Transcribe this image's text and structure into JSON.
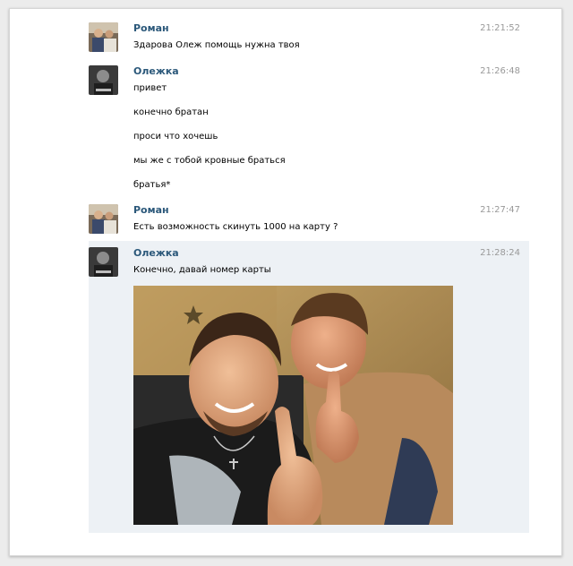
{
  "colors": {
    "author_link": "#2b587a",
    "timestamp": "#999999",
    "highlight_bg": "#edf1f5"
  },
  "messages": [
    {
      "author": "Роман",
      "time": "21:21:52",
      "avatar_icon": "user-avatar-roman",
      "lines": [
        "Здарова Олеж помощь нужна твоя"
      ]
    },
    {
      "author": "Олежка",
      "time": "21:26:48",
      "avatar_icon": "user-avatar-olezhka",
      "lines": [
        "привет",
        "конечно братан",
        "проси что хочешь",
        "мы же с тобой кровные браться",
        "братья*"
      ]
    },
    {
      "author": "Роман",
      "time": "21:27:47",
      "avatar_icon": "user-avatar-roman",
      "lines": [
        "Есть возможность скинуть 1000 на карту ?"
      ]
    },
    {
      "author": "Олежка",
      "time": "21:28:24",
      "avatar_icon": "user-avatar-olezhka",
      "lines": [
        "Конечно, давай номер карты"
      ],
      "attachment": "photo-attachment"
    }
  ]
}
